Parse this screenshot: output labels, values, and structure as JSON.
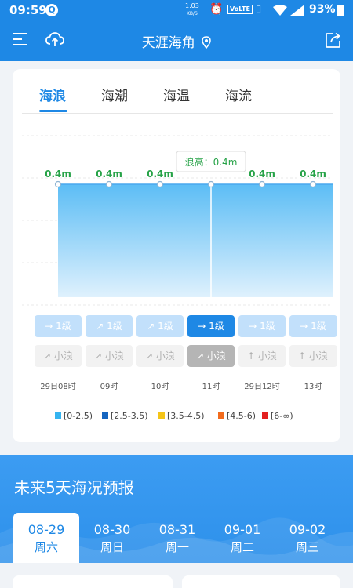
{
  "status": {
    "time": "09:59",
    "netspeed_value": "1.03",
    "netspeed_unit": "KB/S",
    "volte": "VoLTE",
    "battery": "93%"
  },
  "appbar": {
    "title": "天涯海角"
  },
  "tabs": [
    {
      "label": "海浪",
      "active": true
    },
    {
      "label": "海潮",
      "active": false
    },
    {
      "label": "海温",
      "active": false
    },
    {
      "label": "海流",
      "active": false
    }
  ],
  "chart_data": {
    "type": "area",
    "x": [
      "29日08时",
      "09时",
      "10时",
      "11时",
      "29日12时",
      "13时"
    ],
    "values": [
      0.4,
      0.4,
      0.4,
      0.4,
      0.4,
      0.4
    ],
    "point_labels": [
      "0.4m",
      "0.4m",
      "0.4m",
      "",
      "0.4m",
      "0.4m"
    ],
    "tooltip": "浪高：0.4m",
    "selected_index": 3,
    "ylim": [
      0,
      0.6
    ],
    "color": "#5cbdf5"
  },
  "levels": [
    "→ 1级",
    "↗ 1级",
    "↗ 1级",
    "→ 1级",
    "→ 1级",
    "→ 1级"
  ],
  "levels_selected": 3,
  "waves": [
    "↗ 小浪",
    "↗ 小浪",
    "↗ 小浪",
    "↗ 小浪",
    "↑ 小浪",
    "↑ 小浪"
  ],
  "waves_selected": 3,
  "times": [
    "29日08时",
    "09时",
    "10时",
    "11时",
    "29日12时",
    "13时"
  ],
  "legend": [
    {
      "label": "[0-2.5)",
      "color": "#35b4f0"
    },
    {
      "label": "[2.5-3.5)",
      "color": "#1565c0"
    },
    {
      "label": "[3.5-4.5)",
      "color": "#f5c518"
    },
    {
      "label": "[4.5-6)",
      "color": "#f26b1d"
    },
    {
      "label": "[6-∞)",
      "color": "#e32020"
    }
  ],
  "forecast": {
    "title": "未来5天海况预报",
    "days": [
      {
        "date": "08-29",
        "week": "周六",
        "active": true
      },
      {
        "date": "08-30",
        "week": "周日",
        "active": false
      },
      {
        "date": "08-31",
        "week": "周一",
        "active": false
      },
      {
        "date": "09-01",
        "week": "周二",
        "active": false
      },
      {
        "date": "09-02",
        "week": "周三",
        "active": false
      }
    ]
  }
}
